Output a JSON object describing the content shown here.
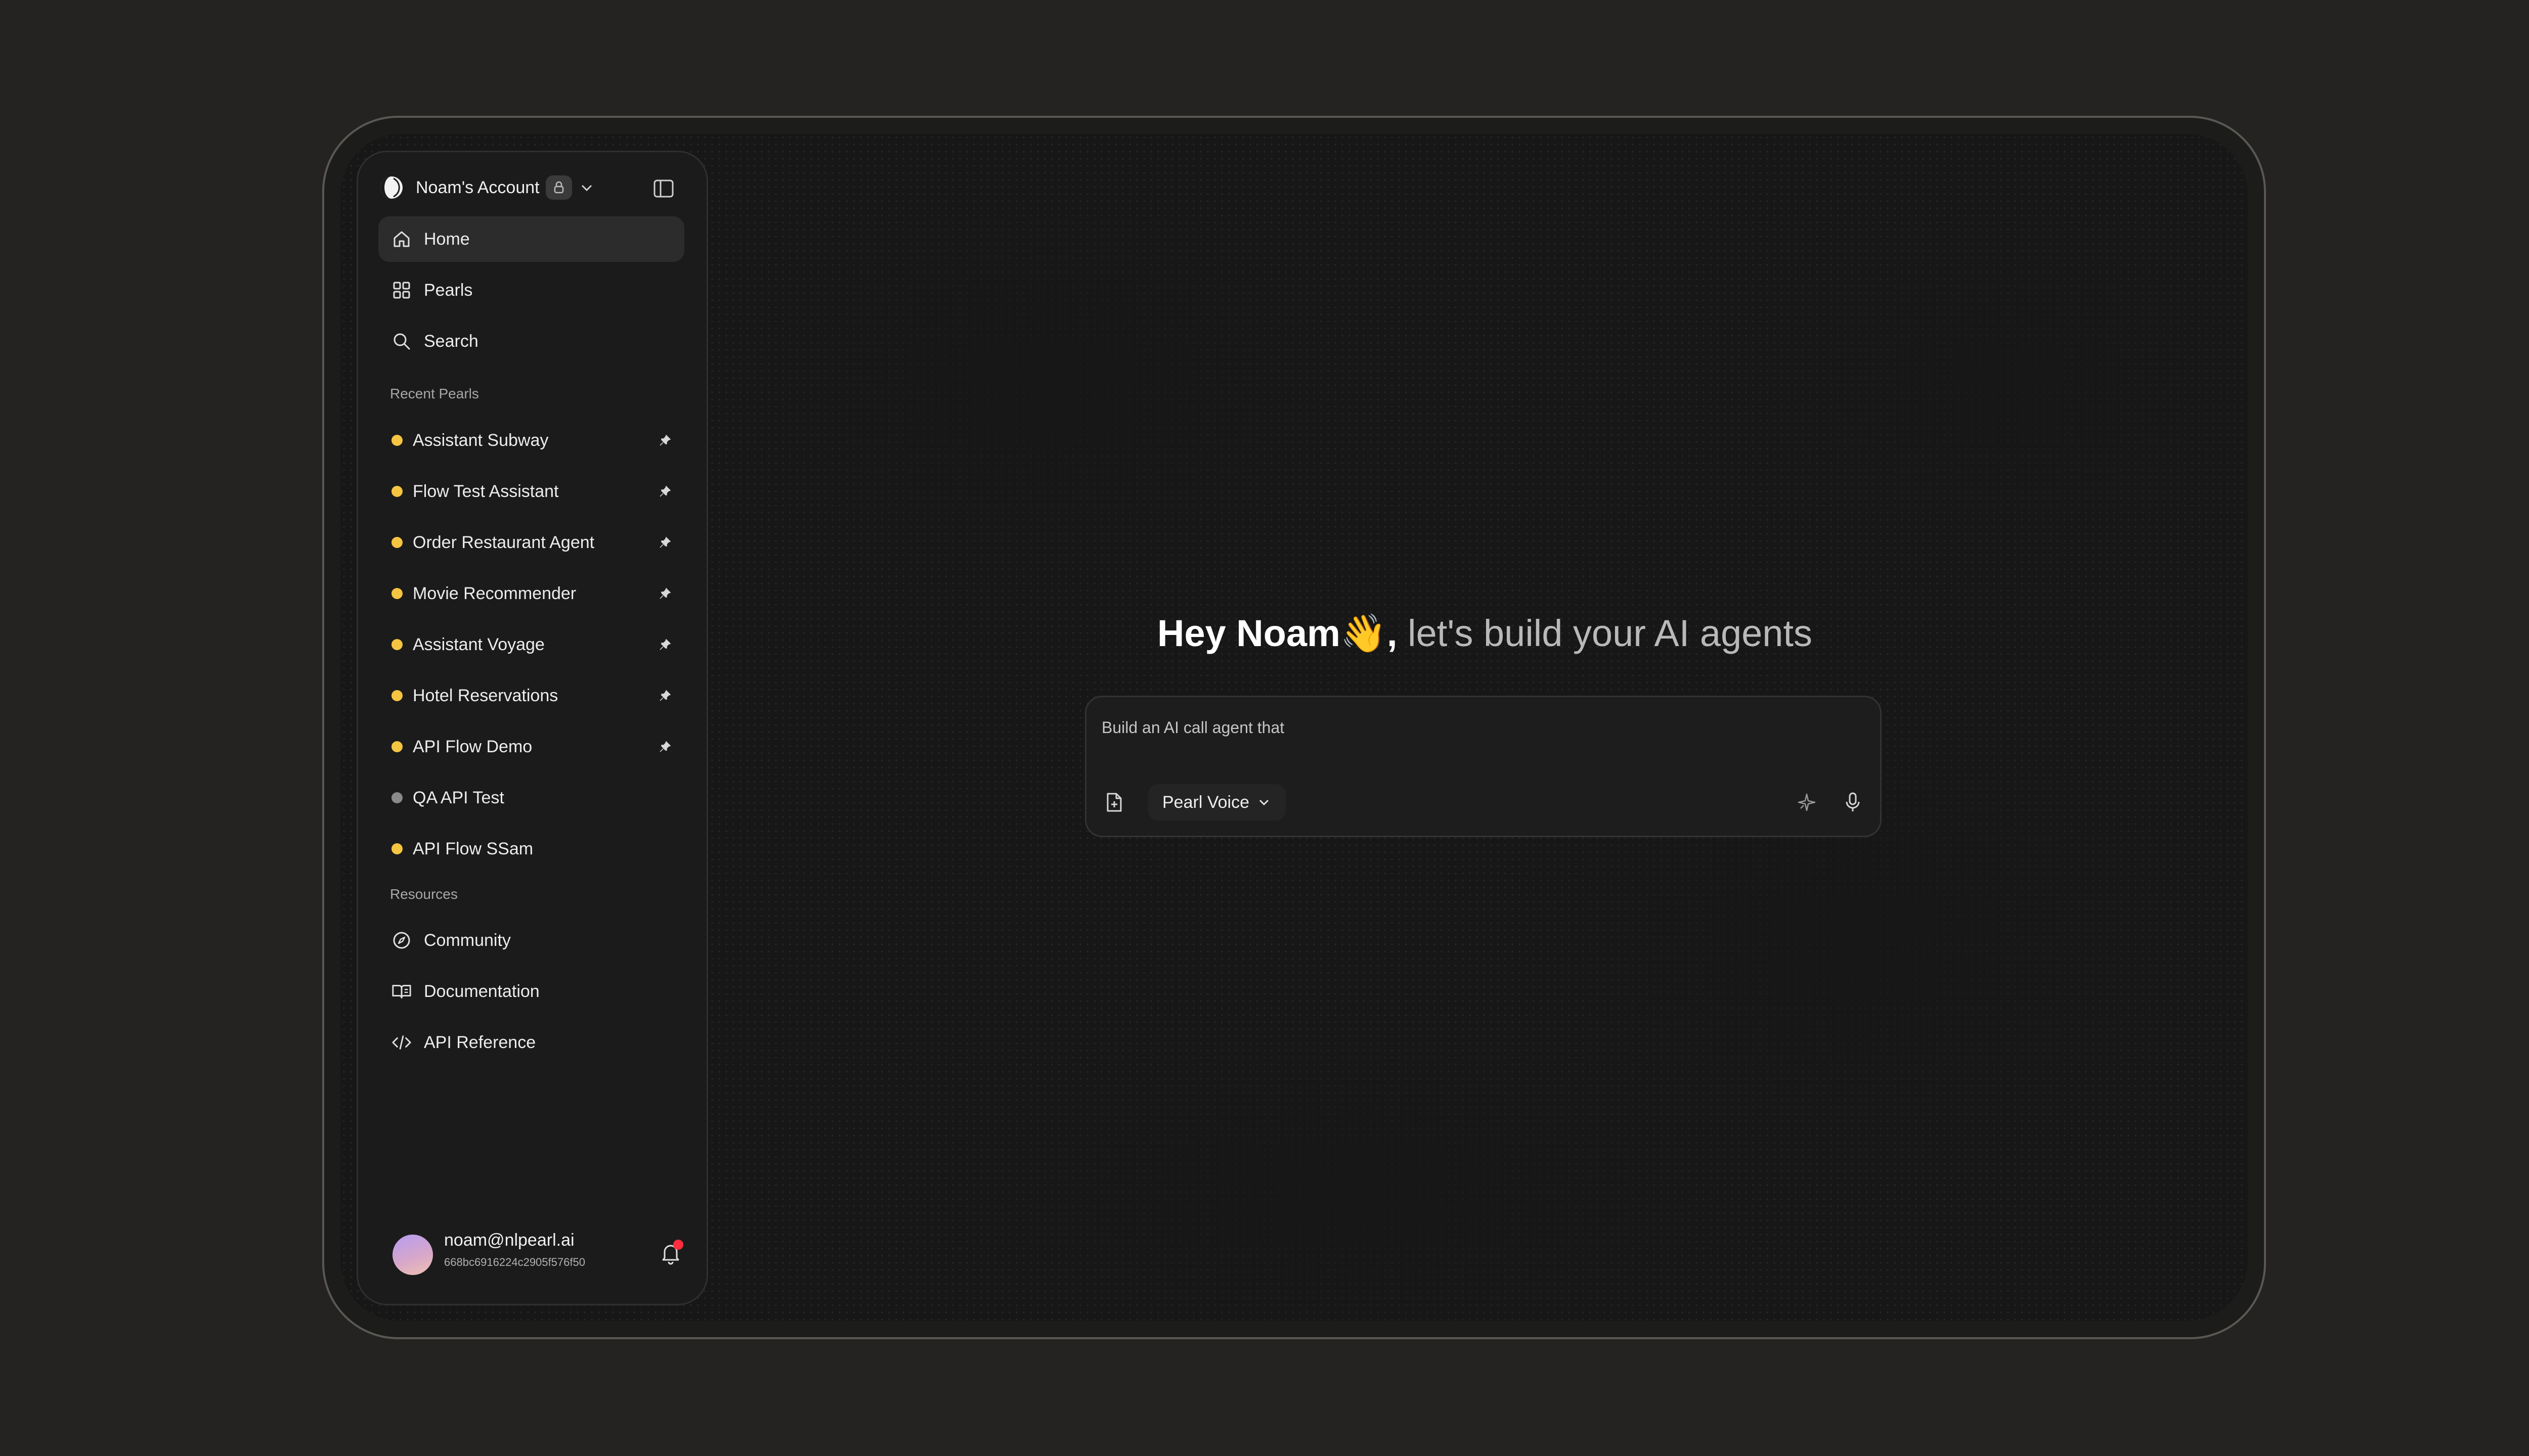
{
  "account": {
    "name": "Noam's Account",
    "logo_icon": "pearl-logo-icon",
    "badge_icon": "lock-icon",
    "dropdown_icon": "chevron-down-icon",
    "collapse_icon": "sidebar-toggle-icon"
  },
  "nav": [
    {
      "label": "Home",
      "icon": "home-icon",
      "active": true
    },
    {
      "label": "Pearls",
      "icon": "grid-icon",
      "active": false
    },
    {
      "label": "Search",
      "icon": "search-icon",
      "active": false
    }
  ],
  "recent": {
    "title": "Recent Pearls",
    "items": [
      {
        "label": "Assistant Subway",
        "status_color": "#f5c542",
        "pinned": true
      },
      {
        "label": "Flow Test Assistant",
        "status_color": "#f5c542",
        "pinned": true
      },
      {
        "label": "Order Restaurant Agent",
        "status_color": "#f5c542",
        "pinned": true
      },
      {
        "label": "Movie Recommender",
        "status_color": "#f5c542",
        "pinned": true
      },
      {
        "label": "Assistant Voyage",
        "status_color": "#f5c542",
        "pinned": true
      },
      {
        "label": "Hotel Reservations",
        "status_color": "#f5c542",
        "pinned": true
      },
      {
        "label": "API Flow Demo",
        "status_color": "#f5c542",
        "pinned": true
      },
      {
        "label": "QA API Test",
        "status_color": "#8a8a8a",
        "pinned": false
      },
      {
        "label": "API Flow SSam",
        "status_color": "#f5c542",
        "pinned": false
      }
    ]
  },
  "resources": {
    "title": "Resources",
    "items": [
      {
        "label": "Community",
        "icon": "compass-icon"
      },
      {
        "label": "Documentation",
        "icon": "book-icon"
      },
      {
        "label": "API Reference",
        "icon": "code-icon"
      }
    ]
  },
  "user": {
    "email": "noam@nlpearl.ai",
    "id": "668bc6916224c2905f576f50",
    "notification_icon": "bell-icon"
  },
  "main": {
    "greeting_strong": "Hey Noam👋,",
    "greeting_soft": "let's build your AI agents",
    "prompt_placeholder": "Build an AI call agent that",
    "voice_label": "Pearl Voice",
    "attach_icon": "file-attach-icon",
    "enhance_icon": "sparkle-icon",
    "mic_icon": "microphone-icon"
  },
  "colors": {
    "background": "#242321",
    "screen": "#171717",
    "sidebar": "#1b1b1b",
    "active_item": "#2c2c2c",
    "pearl_active": "#f5c542",
    "pearl_inactive": "#8a8a8a",
    "notification": "#ff2d3d"
  }
}
